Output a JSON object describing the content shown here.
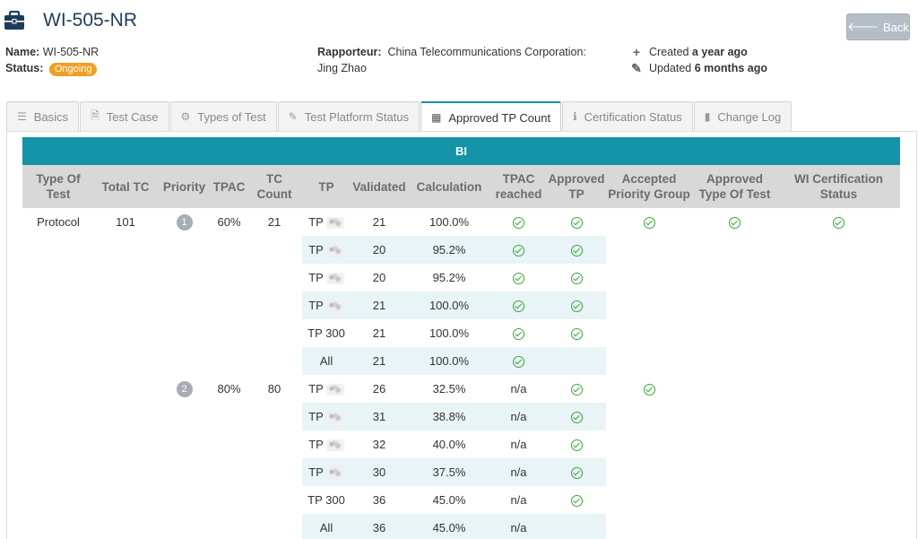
{
  "header": {
    "title": "WI-505-NR",
    "back_label": "Back"
  },
  "meta": {
    "name_label": "Name:",
    "name_value": "WI-505-NR",
    "status_label": "Status:",
    "status_value": "Ongoing",
    "rapporteur_label": "Rapporteur:",
    "rapporteur_org": "China Telecommunications Corporation:",
    "rapporteur_name": "Jing Zhao",
    "created_label": "Created",
    "created_value": "a year ago",
    "updated_label": "Updated",
    "updated_value": "6 months ago"
  },
  "tabs": [
    {
      "label": "Basics",
      "icon": "list-icon"
    },
    {
      "label": "Test Case",
      "icon": "document-icon"
    },
    {
      "label": "Types of Test",
      "icon": "gears-icon"
    },
    {
      "label": "Test Platform Status",
      "icon": "pencil-icon"
    },
    {
      "label": "Approved TP Count",
      "icon": "calculator-icon",
      "active": true
    },
    {
      "label": "Certification Status",
      "icon": "info-icon"
    },
    {
      "label": "Change Log",
      "icon": "book-icon"
    }
  ],
  "table": {
    "section": "BI",
    "columns": [
      "Type Of Test",
      "Total TC",
      "Priority",
      "TPAC",
      "TC Count",
      "TP",
      "Validated",
      "Calculation",
      "TPAC reached",
      "Approved TP",
      "Accepted Priority Group",
      "Approved Type Of Test",
      "WI Certification Status"
    ],
    "type_of_test": "Protocol",
    "total_tc": "101",
    "groups": [
      {
        "priority": "1",
        "tpac": "60%",
        "tc_count": "21",
        "accepted_priority_group": true,
        "rows": [
          {
            "tp": "TP",
            "blurred": true,
            "validated": "21",
            "calc": "100.0%",
            "tpac_reached": "check",
            "approved_tp": true
          },
          {
            "tp": "TP",
            "blurred": true,
            "validated": "20",
            "calc": "95.2%",
            "tpac_reached": "check",
            "approved_tp": true
          },
          {
            "tp": "TP",
            "blurred": true,
            "validated": "20",
            "calc": "95.2%",
            "tpac_reached": "check",
            "approved_tp": true
          },
          {
            "tp": "TP",
            "blurred": true,
            "validated": "21",
            "calc": "100.0%",
            "tpac_reached": "check",
            "approved_tp": true
          },
          {
            "tp": "TP 300",
            "blurred": false,
            "validated": "21",
            "calc": "100.0%",
            "tpac_reached": "check",
            "approved_tp": true
          },
          {
            "tp": "All",
            "blurred": false,
            "validated": "21",
            "calc": "100.0%",
            "tpac_reached": "check",
            "approved_tp": false
          }
        ]
      },
      {
        "priority": "2",
        "tpac": "80%",
        "tc_count": "80",
        "accepted_priority_group": true,
        "rows": [
          {
            "tp": "TP",
            "blurred": true,
            "validated": "26",
            "calc": "32.5%",
            "tpac_reached": "n/a",
            "approved_tp": true
          },
          {
            "tp": "TP",
            "blurred": true,
            "validated": "31",
            "calc": "38.8%",
            "tpac_reached": "n/a",
            "approved_tp": true
          },
          {
            "tp": "TP",
            "blurred": true,
            "validated": "32",
            "calc": "40.0%",
            "tpac_reached": "n/a",
            "approved_tp": true
          },
          {
            "tp": "TP",
            "blurred": true,
            "validated": "30",
            "calc": "37.5%",
            "tpac_reached": "n/a",
            "approved_tp": true
          },
          {
            "tp": "TP 300",
            "blurred": false,
            "validated": "36",
            "calc": "45.0%",
            "tpac_reached": "n/a",
            "approved_tp": true
          },
          {
            "tp": "All",
            "blurred": false,
            "validated": "36",
            "calc": "45.0%",
            "tpac_reached": "n/a",
            "approved_tp": false
          }
        ]
      }
    ],
    "approved_type_of_test": true,
    "wi_certification_status": true
  },
  "colors": {
    "accent": "#1593a8",
    "status_badge": "#f0a027",
    "title": "#1c3d5a",
    "check": "#3aa43a",
    "band": "#e8f4f5"
  }
}
